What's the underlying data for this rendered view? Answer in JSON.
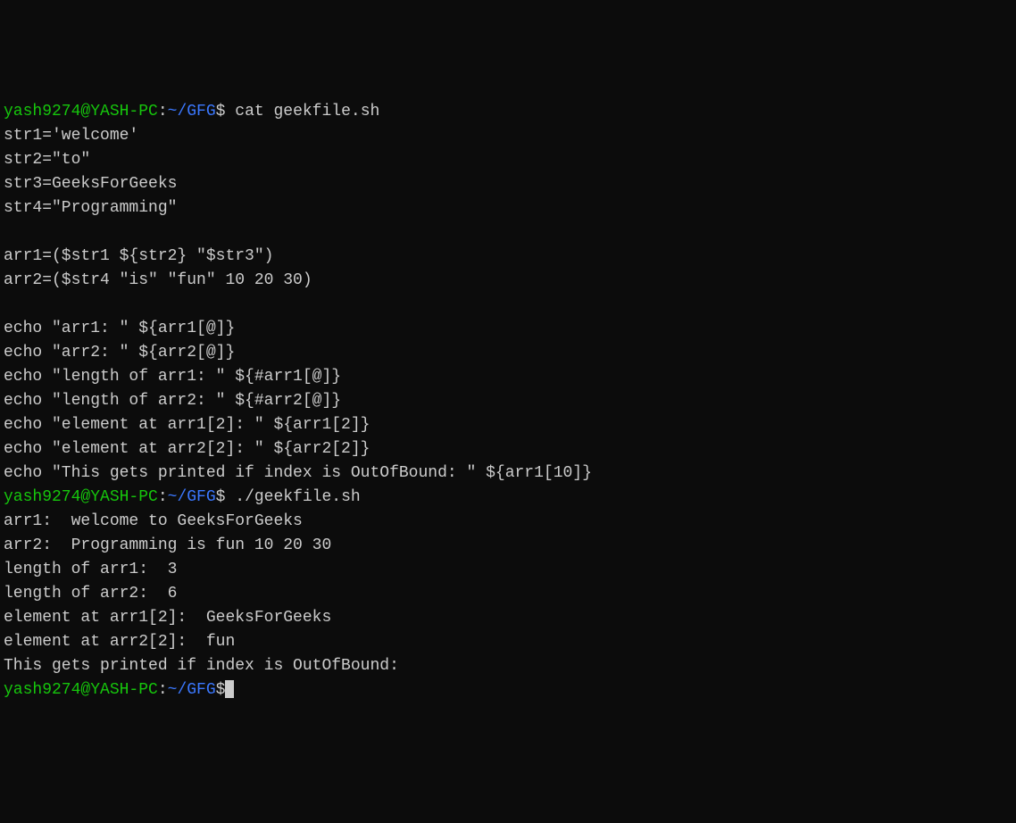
{
  "prompt1": {
    "user": "yash9274@YASH-PC",
    "colon": ":",
    "path": "~/GFG",
    "dollar": "$",
    "command": " cat geekfile.sh"
  },
  "file_lines": [
    "str1='welcome'",
    "str2=\"to\"",
    "str3=GeeksForGeeks",
    "str4=\"Programming\"",
    "",
    "arr1=($str1 ${str2} \"$str3\")",
    "arr2=($str4 \"is\" \"fun\" 10 20 30)",
    "",
    "echo \"arr1: \" ${arr1[@]}",
    "echo \"arr2: \" ${arr2[@]}",
    "echo \"length of arr1: \" ${#arr1[@]}",
    "echo \"length of arr2: \" ${#arr2[@]}",
    "echo \"element at arr1[2]: \" ${arr1[2]}",
    "echo \"element at arr2[2]: \" ${arr2[2]}",
    "echo \"This gets printed if index is OutOfBound: \" ${arr1[10]}"
  ],
  "prompt2": {
    "user": "yash9274@YASH-PC",
    "colon": ":",
    "path": "~/GFG",
    "dollar": "$",
    "command": " ./geekfile.sh"
  },
  "output_lines": [
    "arr1:  welcome to GeeksForGeeks",
    "arr2:  Programming is fun 10 20 30",
    "length of arr1:  3",
    "length of arr2:  6",
    "element at arr1[2]:  GeeksForGeeks",
    "element at arr2[2]:  fun",
    "This gets printed if index is OutOfBound:"
  ],
  "prompt3": {
    "user": "yash9274@YASH-PC",
    "colon": ":",
    "path": "~/GFG",
    "dollar": "$"
  }
}
